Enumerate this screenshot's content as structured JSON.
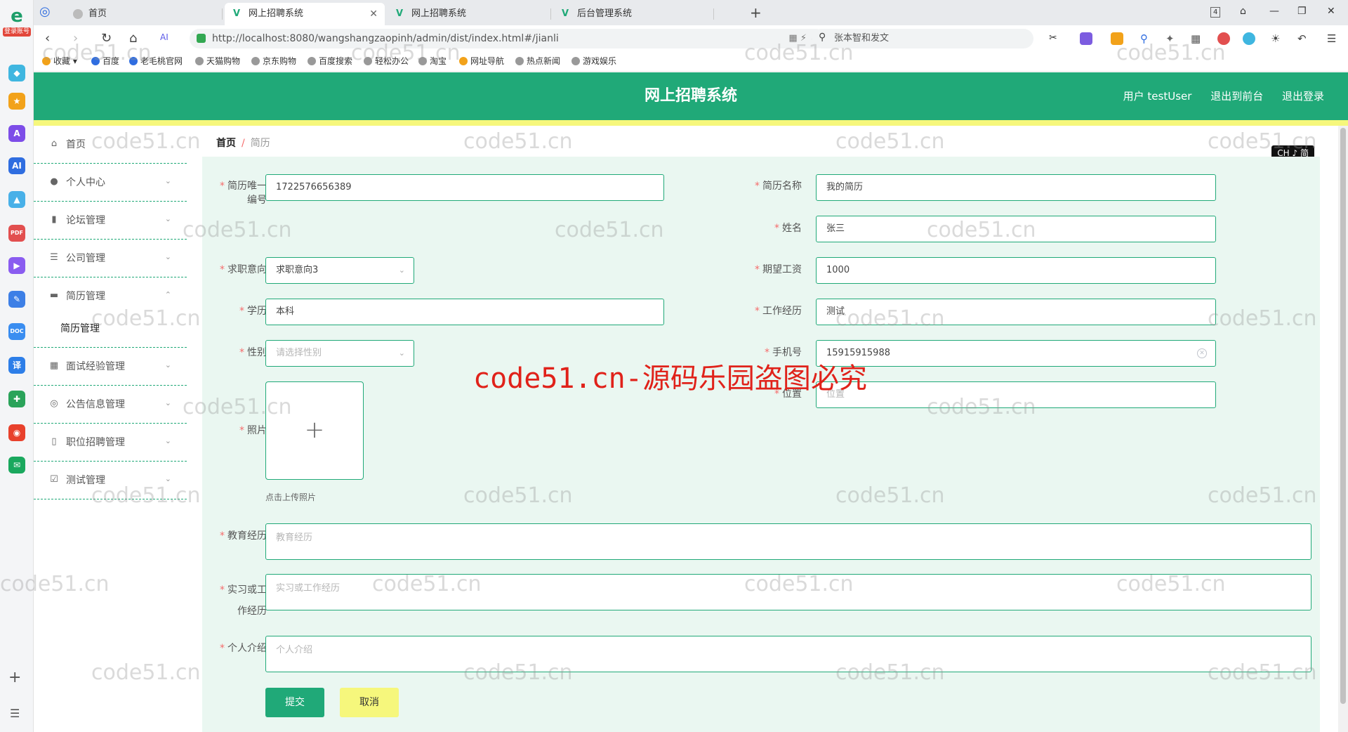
{
  "browser": {
    "logo_letter": "e",
    "logo_tag": "登录账号",
    "tabs": [
      {
        "label": "首页",
        "active": false
      },
      {
        "label": "网上招聘系统",
        "active": true
      },
      {
        "label": "网上招聘系统",
        "active": false
      },
      {
        "label": "后台管理系统",
        "active": false
      }
    ],
    "new_tab": "+",
    "tab_count": "4",
    "url": "http://localhost:8080/wangshangzaopinh/admin/dist/index.html#/jianli",
    "search_text": "张本智和发文",
    "bookmarks": [
      "收藏",
      "百度",
      "老毛桃官网",
      "天猫购物",
      "京东购物",
      "百度搜索",
      "轻松办公",
      "淘宝",
      "网址导航",
      "热点新闻",
      "游戏娱乐"
    ]
  },
  "header": {
    "title": "网上招聘系统",
    "user": "用户 testUser",
    "to_front": "退出到前台",
    "logout": "退出登录"
  },
  "sidebar": {
    "items": [
      {
        "label": "首页",
        "icon": "home-icon"
      },
      {
        "label": "个人中心",
        "icon": "user-icon"
      },
      {
        "label": "论坛管理",
        "icon": "forum-icon"
      },
      {
        "label": "公司管理",
        "icon": "list-icon"
      },
      {
        "label": "简历管理",
        "icon": "chat-icon"
      },
      {
        "label": "面试经验管理",
        "icon": "grid-icon"
      },
      {
        "label": "公告信息管理",
        "icon": "notice-icon"
      },
      {
        "label": "职位招聘管理",
        "icon": "job-icon"
      },
      {
        "label": "测试管理",
        "icon": "check-icon"
      }
    ],
    "sub_item": "简历管理"
  },
  "breadcrumb": {
    "home": "首页",
    "sep": "/",
    "current": "简历"
  },
  "lang_badge": "CH ♪ 简",
  "form": {
    "resume_no_label_1": "简历唯一",
    "resume_no_label_2": "编号",
    "resume_no": "1722576656389",
    "resume_name_label": "简历名称",
    "resume_name": "我的简历",
    "name_label": "姓名",
    "name": "张三",
    "intention_label": "求职意向",
    "intention": "求职意向3",
    "salary_label": "期望工资",
    "salary": "1000",
    "education_label": "学历",
    "education": "本科",
    "experience_label": "工作经历",
    "experience": "测试",
    "gender_label": "性别",
    "gender_placeholder": "请选择性别",
    "phone_label": "手机号",
    "phone": "15915915988",
    "location_label": "位置",
    "location_placeholder": "位置",
    "photo_label": "照片",
    "photo_tip": "点击上传照片",
    "edu_history_label": "教育经历",
    "edu_history_placeholder": "教育经历",
    "intern_label_1": "实习或工",
    "intern_label_2": "作经历",
    "intern_placeholder": "实习或工作经历",
    "intro_label": "个人介绍",
    "intro_placeholder": "个人介绍",
    "submit": "提交",
    "cancel": "取消"
  },
  "watermark": {
    "small": "code51.cn",
    "big": "code51.cn-源码乐园盗图必究"
  },
  "colors": {
    "accent": "#20a978",
    "yellow": "#f6f77c",
    "required": "#f56c6c"
  }
}
